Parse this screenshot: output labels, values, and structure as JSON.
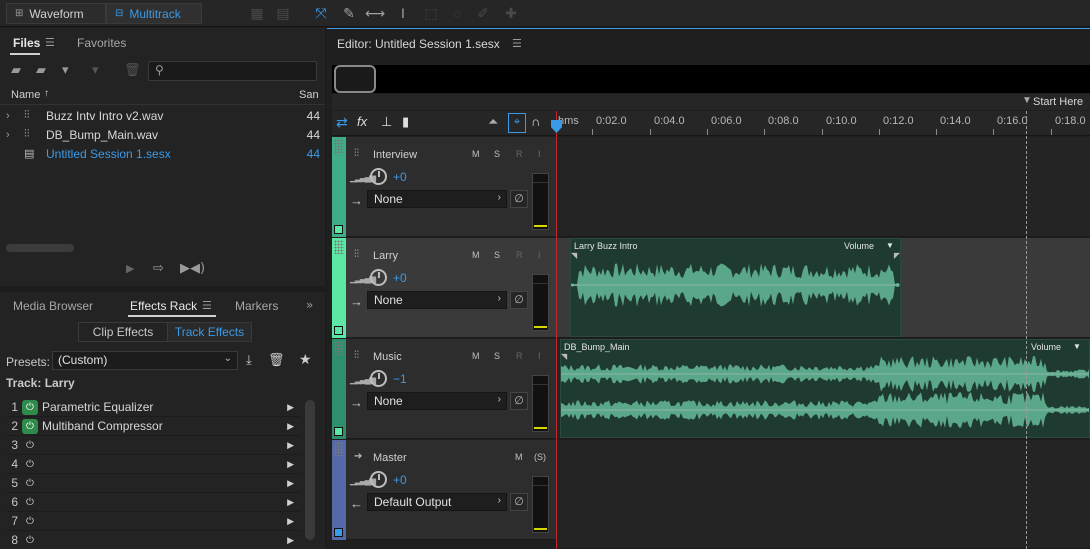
{
  "toolbar": {
    "waveform_label": "Waveform",
    "multitrack_label": "Multitrack"
  },
  "files_panel": {
    "tabs": [
      "Files",
      "Favorites"
    ],
    "col_name": "Name",
    "col_sample": "San",
    "files": [
      {
        "name": "Buzz Intv Intro v2.wav",
        "rate": "44"
      },
      {
        "name": "DB_Bump_Main.wav",
        "rate": "44"
      },
      {
        "name": "Untitled Session 1.sesx",
        "rate": "44"
      }
    ]
  },
  "lower_panel": {
    "tabs": [
      "Media Browser",
      "Effects Rack",
      "Markers"
    ],
    "subtabs": [
      "Clip Effects",
      "Track Effects"
    ],
    "presets_label": "Presets:",
    "preset_value": "(Custom)",
    "track_label": "Track: Larry",
    "effects": [
      {
        "num": "1",
        "name": "Parametric Equalizer",
        "on": true
      },
      {
        "num": "2",
        "name": "Multiband Compressor",
        "on": true
      },
      {
        "num": "3",
        "name": "",
        "on": false
      },
      {
        "num": "4",
        "name": "",
        "on": false
      },
      {
        "num": "5",
        "name": "",
        "on": false
      },
      {
        "num": "6",
        "name": "",
        "on": false
      },
      {
        "num": "7",
        "name": "",
        "on": false
      },
      {
        "num": "8",
        "name": "",
        "on": false
      }
    ]
  },
  "editor": {
    "title": "Editor: Untitled Session 1.sesx",
    "start_here": "Start Here",
    "ruler_labels": [
      "hms",
      "0:02.0",
      "0:04.0",
      "0:06.0",
      "0:08.0",
      "0:10.0",
      "0:12.0",
      "0:14.0",
      "0:16.0",
      "0:18.0"
    ],
    "tracks": [
      {
        "name": "Interview",
        "volume": "+0",
        "route": "None",
        "color": "#3fae88"
      },
      {
        "name": "Larry",
        "volume": "+0",
        "route": "None",
        "color": "#5ce7a5"
      },
      {
        "name": "Music",
        "volume": "−1",
        "route": "None",
        "color": "#2f8e6c"
      },
      {
        "name": "Master",
        "volume": "+0",
        "route": "Default Output",
        "color": "#5568a8"
      }
    ],
    "clips": [
      {
        "title": "Larry Buzz Intro",
        "volume_label": "Volume"
      },
      {
        "title": "DB_Bump_Main",
        "volume_label": "Volume"
      }
    ],
    "msri": {
      "m": "M",
      "s": "S",
      "r": "R",
      "i": "I",
      "master_s": "(S)"
    }
  },
  "colors": {
    "accent": "#3b9ae8",
    "clip_bg": "#1f3a30",
    "waveform": "#5aa889",
    "playhead": "#c0282a"
  }
}
